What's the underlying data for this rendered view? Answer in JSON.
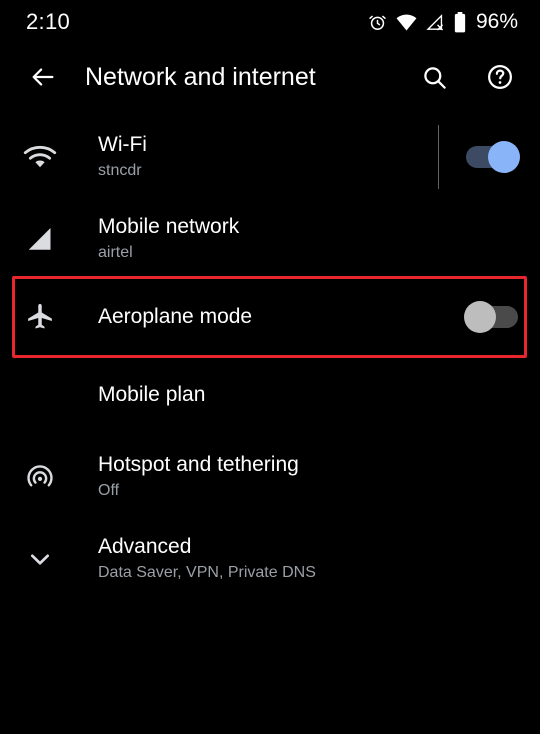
{
  "status_bar": {
    "clock": "2:10",
    "battery_percent": "96%",
    "icons": [
      "alarm-icon",
      "wifi-icon",
      "mobile-signal-off-icon",
      "battery-icon"
    ]
  },
  "app_bar": {
    "back_icon": "back-arrow-icon",
    "title": "Network and internet",
    "search_icon": "search-icon",
    "help_icon": "help-circle-icon"
  },
  "colors": {
    "background": "#000000",
    "primary_text": "#ffffff",
    "secondary_text": "#9aa0a6",
    "toggle_on_thumb": "#8ab4f8",
    "toggle_on_track": "#3c4a63",
    "toggle_off_thumb": "#bdbdbd",
    "toggle_off_track": "#4a4a4a",
    "highlight_border": "#e8262d",
    "divider": "#5f6368"
  },
  "highlight": {
    "target": "Aeroplane mode",
    "color": "#e8262d"
  },
  "rows": [
    {
      "id": "wifi",
      "icon": "wifi-icon",
      "title": "Wi-Fi",
      "subtitle": "stncdr",
      "toggle": "on",
      "toggle_state_label": "On",
      "has_divider": true
    },
    {
      "id": "mobile-network",
      "icon": "signal-bars-icon",
      "title": "Mobile network",
      "subtitle": "airtel",
      "toggle": "none",
      "has_divider": false
    },
    {
      "id": "aeroplane-mode",
      "icon": "airplane-icon",
      "title": "Aeroplane mode",
      "subtitle": "",
      "toggle": "off",
      "toggle_state_label": "Off",
      "has_divider": false,
      "highlighted": true
    },
    {
      "id": "mobile-plan",
      "icon": "none",
      "title": "Mobile plan",
      "subtitle": "",
      "toggle": "none",
      "has_divider": false
    },
    {
      "id": "hotspot-and-tethering",
      "icon": "hotspot-icon",
      "title": "Hotspot and tethering",
      "subtitle": "Off",
      "toggle": "none",
      "has_divider": false
    },
    {
      "id": "advanced",
      "icon": "chevron-down-icon",
      "title": "Advanced",
      "subtitle": "Data Saver, VPN, Private DNS",
      "toggle": "none",
      "has_divider": false
    }
  ]
}
